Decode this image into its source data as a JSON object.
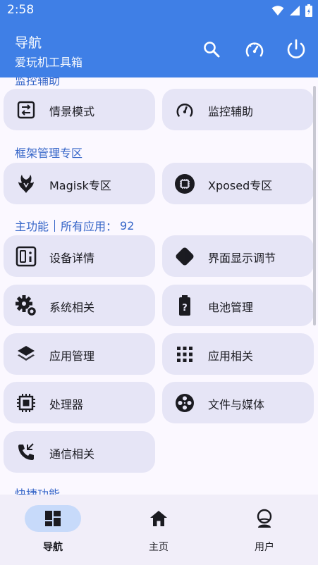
{
  "status_bar": {
    "time": "2:58"
  },
  "app_bar": {
    "title": "导航",
    "subtitle": "爱玩机工具箱",
    "actions": [
      "search-icon",
      "speedometer-icon",
      "power-icon"
    ]
  },
  "colors": {
    "primary": "#3f7fe6",
    "section_text": "#3565c8",
    "tile_bg": "#e6e5f6",
    "page_bg": "#fbf8ff",
    "nav_bg": "#f1eef9",
    "nav_active_pill": "#c7dafa"
  },
  "sections": {
    "monitor": {
      "label": "监控辅助",
      "tiles": [
        {
          "label": "情景模式",
          "icon": "swap-arrows-icon"
        },
        {
          "label": "监控辅助",
          "icon": "speedometer-icon"
        }
      ]
    },
    "framework": {
      "label": "框架管理专区",
      "tiles": [
        {
          "label": "Magisk专区",
          "icon": "magisk-icon"
        },
        {
          "label": "Xposed专区",
          "icon": "chip-circle-icon"
        }
      ]
    },
    "main": {
      "label": "主功能",
      "apps_label": "所有应用：",
      "apps_count": "92",
      "tiles": [
        {
          "label": "设备详情",
          "icon": "device-icon"
        },
        {
          "label": "界面显示调节",
          "icon": "display-diamond-icon"
        },
        {
          "label": "系统相关",
          "icon": "gear-icon"
        },
        {
          "label": "电池管理",
          "icon": "battery-icon"
        },
        {
          "label": "应用管理",
          "icon": "layers-icon"
        },
        {
          "label": "应用相关",
          "icon": "grid-icon"
        },
        {
          "label": "处理器",
          "icon": "processor-icon"
        },
        {
          "label": "文件与媒体",
          "icon": "film-reel-icon"
        },
        {
          "label": "通信相关",
          "icon": "phone-icon"
        }
      ]
    },
    "shortcuts": {
      "label": "快捷功能"
    }
  },
  "bottom_nav": [
    {
      "label": "导航",
      "icon": "dashboard-icon",
      "active": true
    },
    {
      "label": "主页",
      "icon": "home-icon",
      "active": false
    },
    {
      "label": "用户",
      "icon": "user-icon",
      "active": false
    }
  ]
}
